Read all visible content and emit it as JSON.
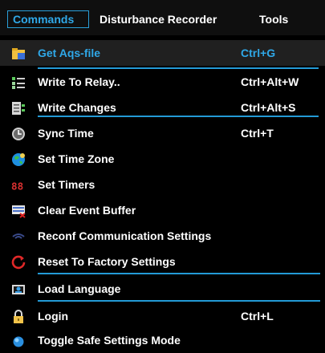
{
  "colors": {
    "accent": "#2fa8e8",
    "separator": "#239ad6",
    "background": "#000000",
    "text": "#ffffff"
  },
  "menubar": {
    "items": [
      {
        "label": "Commands",
        "active": true
      },
      {
        "label": "Disturbance Recorder",
        "active": false
      },
      {
        "label": "Tools",
        "active": false
      }
    ]
  },
  "menu": {
    "items": [
      {
        "label": "Get Aqs-file",
        "shortcut": "Ctrl+G",
        "icon": "folder-icon",
        "highlighted": true
      },
      {
        "label": "Write To Relay..",
        "shortcut": "Ctrl+Alt+W",
        "icon": "relay-write-icon"
      },
      {
        "label": "Write Changes",
        "shortcut": "Ctrl+Alt+S",
        "icon": "list-changes-icon"
      },
      {
        "label": "Sync Time",
        "shortcut": "Ctrl+T",
        "icon": "clock-icon"
      },
      {
        "label": "Set Time Zone",
        "shortcut": "",
        "icon": "globe-icon"
      },
      {
        "label": "Set Timers",
        "shortcut": "",
        "icon": "digits-88-icon"
      },
      {
        "label": "Clear Event Buffer",
        "shortcut": "",
        "icon": "clear-buffer-icon"
      },
      {
        "label": "Reconf Communication Settings",
        "shortcut": "",
        "icon": "communication-icon"
      },
      {
        "label": "Reset To Factory Settings",
        "shortcut": "",
        "icon": "reset-icon"
      },
      {
        "label": "Load Language",
        "shortcut": "",
        "icon": "language-icon"
      },
      {
        "label": "Login",
        "shortcut": "Ctrl+L",
        "icon": "lock-icon"
      },
      {
        "label": "Toggle Safe Settings Mode",
        "shortcut": "",
        "icon": "safe-mode-icon"
      }
    ]
  }
}
